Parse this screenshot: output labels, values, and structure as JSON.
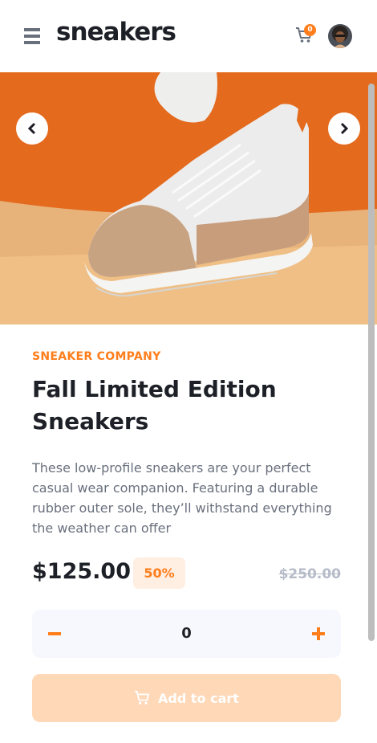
{
  "header": {
    "logo": "sneakers",
    "cart_count": "0"
  },
  "product": {
    "company": "SNEAKER COMPANY",
    "title": "Fall Limited Edition Sneakers",
    "description": "These low-profile sneakers are your perfect casual wear companion. Featuring a durable rubber outer sole, they’ll withstand everything the weather can offer",
    "price": "$125.00",
    "discount": "50%",
    "old_price": "$250.00"
  },
  "quantity": {
    "value": "0"
  },
  "actions": {
    "add_to_cart": "Add to cart"
  },
  "colors": {
    "accent": "#ff7e1b",
    "accent_light": "#ffeee2",
    "button_disabled": "#ffd8b8",
    "text_dark": "#1d2026",
    "text_gray": "#69707d",
    "qty_bg": "#f6f8fd"
  },
  "icons": {
    "menu": "hamburger-menu-icon",
    "cart": "cart-icon",
    "prev": "chevron-left-icon",
    "next": "chevron-right-icon",
    "minus": "minus-icon",
    "plus": "plus-icon"
  }
}
